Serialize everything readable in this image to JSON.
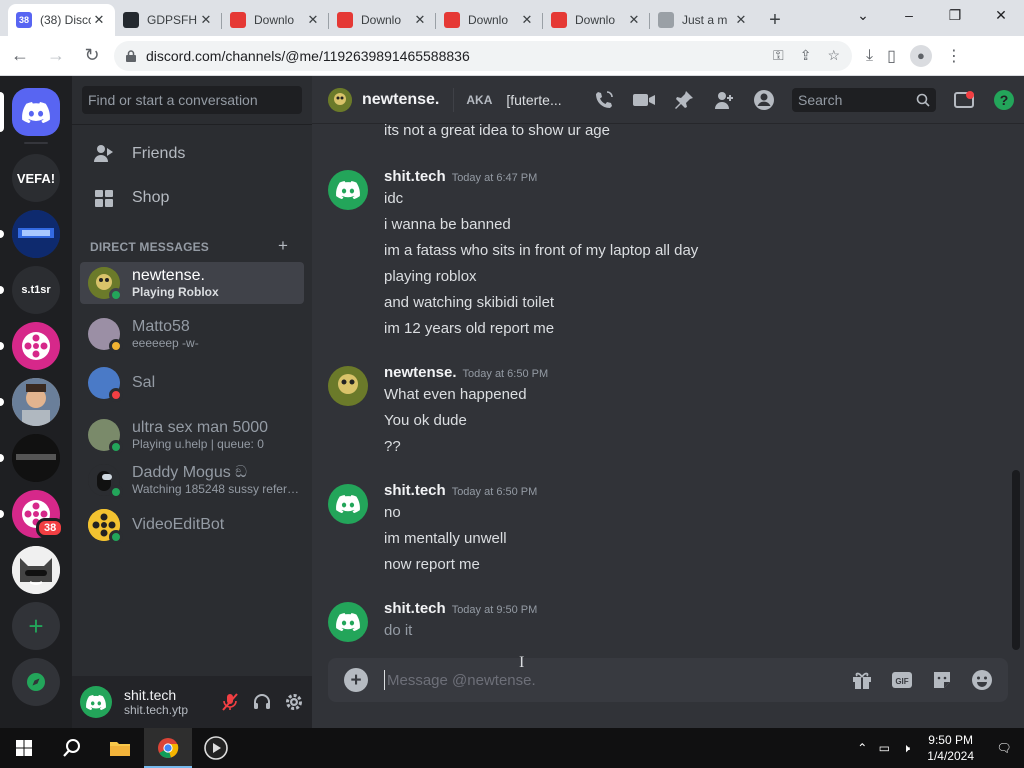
{
  "browser": {
    "tabs": [
      {
        "title": "(38) Disco",
        "badge": "38",
        "fav_color": "#5865f2",
        "active": true
      },
      {
        "title": "GDPSFH",
        "fav_color": "#24292f"
      },
      {
        "title": "Downlo",
        "fav_color": "#e53935"
      },
      {
        "title": "Downlo",
        "fav_color": "#e53935"
      },
      {
        "title": "Downlo",
        "fav_color": "#e53935"
      },
      {
        "title": "Downlo",
        "fav_color": "#e53935"
      },
      {
        "title": "Just a m",
        "fav_color": "#9aa0a6"
      }
    ],
    "new_tab": "+",
    "url": "discord.com/channels/@me/1192639891465588836"
  },
  "servers": [
    {
      "kind": "home"
    },
    {
      "label": "VEFA!",
      "bg": "#2b2d31"
    },
    {
      "label": "",
      "bg": "#1b3a8a",
      "img": "glow"
    },
    {
      "label": "s.t1sr",
      "bg": "#2b2d31"
    },
    {
      "label": "",
      "bg": "#d6288a",
      "img": "reel"
    },
    {
      "label": "",
      "bg": "#c9a27e",
      "img": "kid"
    },
    {
      "label": "",
      "bg": "#111",
      "img": "dark"
    },
    {
      "label": "",
      "bg": "#d6288a",
      "img": "reel",
      "badge": "38"
    },
    {
      "label": "",
      "bg": "#e8e8e8",
      "img": "cat"
    },
    {
      "kind": "add"
    },
    {
      "kind": "explore"
    }
  ],
  "dm_sidebar": {
    "search_placeholder": "Find or start a conversation",
    "friends": "Friends",
    "shop": "Shop",
    "section_label": "DIRECT MESSAGES",
    "add": "+",
    "dms": [
      {
        "name": "newtense.",
        "sub": "Playing Roblox",
        "selected": true,
        "status": "#23a55a",
        "avatar": "#5a6a1a"
      },
      {
        "name": "Matto58",
        "sub": "eeeeeep -w-",
        "status": "#f0b232",
        "avatar": "#9b8fa5"
      },
      {
        "name": "Sal",
        "sub": "",
        "status": "#f23f43",
        "avatar": "#4a7ac7"
      },
      {
        "name": "ultra sex man 5000",
        "sub": "Playing u.help | queue: 0",
        "status": "#23a55a",
        "avatar": "#7a8a6a"
      },
      {
        "name": "Daddy Mogus ඞ",
        "sub": "Watching 185248 sussy references",
        "status": "#23a55a",
        "avatar": "#222"
      },
      {
        "name": "VideoEditBot",
        "sub": "",
        "status": "#23a55a",
        "avatar": "#f2c230"
      }
    ]
  },
  "user_panel": {
    "name": "shit.tech",
    "tag": "shit.tech.ytp"
  },
  "chat": {
    "header_name": "newtense.",
    "aka_label": "AKA",
    "aka_value": "[futerte...",
    "search_placeholder": "Search",
    "messages": [
      {
        "type": "line",
        "text": "its not a great idea to show ur age"
      },
      {
        "type": "author",
        "name": "shit.tech",
        "time": "Today at 6:47 PM",
        "avatar": "discord"
      },
      {
        "type": "line",
        "text": "idc"
      },
      {
        "type": "line",
        "text": "i wanna be banned"
      },
      {
        "type": "line",
        "text": "im a fatass who sits in front of my laptop all day"
      },
      {
        "type": "line",
        "text": "playing roblox"
      },
      {
        "type": "line",
        "text": "and watching skibidi toilet"
      },
      {
        "type": "line",
        "text": "im 12 years old report me"
      },
      {
        "type": "author",
        "name": "newtense.",
        "time": "Today at 6:50 PM",
        "avatar": "skull"
      },
      {
        "type": "line",
        "text": "What even happened"
      },
      {
        "type": "line",
        "text": "You ok dude"
      },
      {
        "type": "line",
        "text": "??"
      },
      {
        "type": "author",
        "name": "shit.tech",
        "time": "Today at 6:50 PM",
        "avatar": "discord"
      },
      {
        "type": "line",
        "text": "no"
      },
      {
        "type": "line",
        "text": "im mentally unwell"
      },
      {
        "type": "line",
        "text": "now report me"
      },
      {
        "type": "author",
        "name": "shit.tech",
        "time": "Today at 9:50 PM",
        "avatar": "discord"
      },
      {
        "type": "line",
        "text": "do it",
        "dim": true
      }
    ],
    "composer_placeholder": "Message @newtense."
  },
  "taskbar": {
    "time": "9:50 PM",
    "date": "1/4/2024"
  },
  "colors": {
    "blurple": "#5865f2",
    "green": "#23a55a"
  }
}
